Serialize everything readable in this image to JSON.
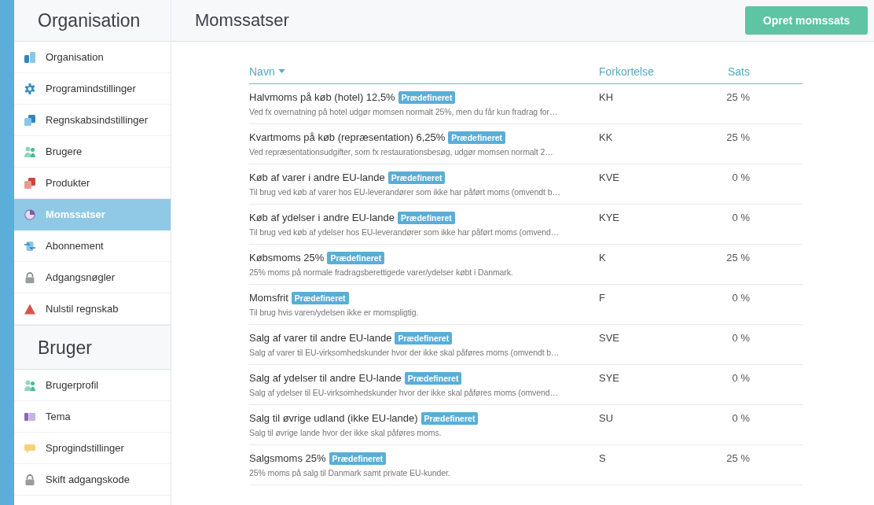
{
  "sidebar": {
    "sections": [
      {
        "title": "Organisation",
        "items": [
          {
            "label": "Organisation",
            "selected": false
          },
          {
            "label": "Programindstillinger",
            "selected": false
          },
          {
            "label": "Regnskabsindstillinger",
            "selected": false
          },
          {
            "label": "Brugere",
            "selected": false
          },
          {
            "label": "Produkter",
            "selected": false
          },
          {
            "label": "Momssatser",
            "selected": true
          },
          {
            "label": "Abonnement",
            "selected": false
          },
          {
            "label": "Adgangsnøgler",
            "selected": false
          },
          {
            "label": "Nulstil regnskab",
            "selected": false
          }
        ]
      },
      {
        "title": "Bruger",
        "items": [
          {
            "label": "Brugerprofil",
            "selected": false
          },
          {
            "label": "Tema",
            "selected": false
          },
          {
            "label": "Sprogindstillinger",
            "selected": false
          },
          {
            "label": "Skift adgangskode",
            "selected": false
          }
        ]
      }
    ]
  },
  "header": {
    "title": "Momssatser",
    "button": "Opret momssats"
  },
  "table": {
    "columns": [
      {
        "label": "Navn",
        "sorted": true
      },
      {
        "label": "Forkortelse",
        "sorted": false
      },
      {
        "label": "Sats",
        "sorted": false
      }
    ],
    "rows": [
      {
        "name": "Halvmoms på køb (hotel) 12,5%",
        "badge": "Prædefineret",
        "description": "Ved fx overnatning på hotel udgør momsen normalt 25%, men du får kun fradrag for…",
        "abbreviation": "KH",
        "rate": "25 %"
      },
      {
        "name": "Kvartmoms på køb (repræsentation) 6,25%",
        "badge": "Prædefineret",
        "description": "Ved repræsentationsudgifter, som fx restaurationsbesøg, udgør momsen normalt 2…",
        "abbreviation": "KK",
        "rate": "25 %"
      },
      {
        "name": "Køb af varer i andre EU-lande",
        "badge": "Prædefineret",
        "description": "Til brug ved køb af varer hos EU-leverandører som ikke har påført moms (omvendt b…",
        "abbreviation": "KVE",
        "rate": "0 %"
      },
      {
        "name": "Køb af ydelser i andre EU-lande",
        "badge": "Prædefineret",
        "description": "Til brug ved køb af ydelser hos EU-leverandører som ikke har påført moms (omvend…",
        "abbreviation": "KYE",
        "rate": "0 %"
      },
      {
        "name": "Købsmoms 25%",
        "badge": "Prædefineret",
        "description": "25% moms på normale fradragsberettigede varer/ydelser købt i Danmark.",
        "abbreviation": "K",
        "rate": "25 %"
      },
      {
        "name": "Momsfrit",
        "badge": "Prædefineret",
        "description": "Til brug hvis varen/ydelsen ikke er momspligtig.",
        "abbreviation": "F",
        "rate": "0 %"
      },
      {
        "name": "Salg af varer til andre EU-lande",
        "badge": "Prædefineret",
        "description": "Salg af varer til EU-virksomhedskunder hvor der ikke skal påføres moms (omvendt b…",
        "abbreviation": "SVE",
        "rate": "0 %"
      },
      {
        "name": "Salg af ydelser til andre EU-lande",
        "badge": "Prædefineret",
        "description": "Salg af ydelser til EU-virksomhedskunder hvor der ikke skal påføres moms (omvend…",
        "abbreviation": "SYE",
        "rate": "0 %"
      },
      {
        "name": "Salg til øvrige udland (ikke EU-lande)",
        "badge": "Prædefineret",
        "description": "Salg til øvrige lande hvor der ikke skal påføres moms.",
        "abbreviation": "SU",
        "rate": "0 %"
      },
      {
        "name": "Salgsmoms 25%",
        "badge": "Prædefineret",
        "description": "25% moms på salg til Danmark samt private EU-kunder.",
        "abbreviation": "S",
        "rate": "25 %"
      }
    ]
  }
}
